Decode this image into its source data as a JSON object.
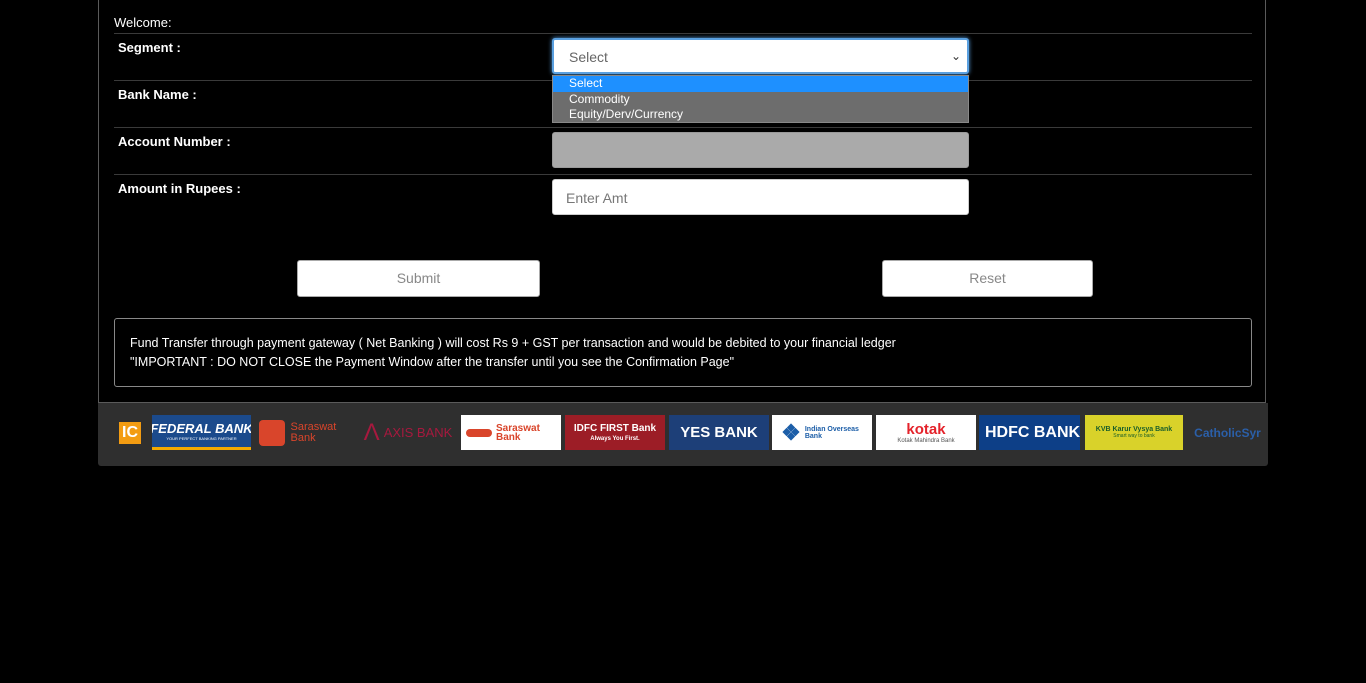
{
  "form": {
    "welcome": "Welcome:",
    "segment_label": "Segment :",
    "segment_value": "Select",
    "segment_options": [
      "Select",
      "Commodity",
      "Equity/Derv/Currency"
    ],
    "bank_name_label": "Bank Name :",
    "account_number_label": "Account Number :",
    "amount_label": "Amount in Rupees :",
    "amount_placeholder": "Enter Amt",
    "submit_label": "Submit",
    "reset_label": "Reset"
  },
  "notice": {
    "line1": "Fund Transfer through payment gateway ( Net Banking ) will cost Rs 9 + GST per transaction and would be debited to your financial ledger",
    "line2": "\"IMPORTANT : DO NOT CLOSE the Payment Window after the transfer until you see the Confirmation Page\""
  },
  "banks": [
    {
      "name": "IC",
      "icon": "ic-logo",
      "bg": "#2f2f2f",
      "fg": "#f39c12"
    },
    {
      "name": "FEDERAL BANK",
      "sub": "YOUR PERFECT BANKING PARTNER",
      "icon": "federal-bank-logo",
      "bg": "#1b4a8c",
      "fg": "#ffffff"
    },
    {
      "name": "Saraswat Bank",
      "icon": "saraswat-bank-logo",
      "bg": "#2f2f2f",
      "fg": "#d9452b"
    },
    {
      "name": "AXIS BANK",
      "icon": "axis-bank-logo",
      "bg": "#2f2f2f",
      "fg": "#a6193e"
    },
    {
      "name": "Saraswat Bank",
      "icon": "saraswat-bank-logo-2",
      "bg": "#ffffff",
      "fg": "#d9452b"
    },
    {
      "name": "IDFC FIRST Bank",
      "sub": "Always You First.",
      "icon": "idfc-first-bank-logo",
      "bg": "#9c1d26",
      "fg": "#ffffff"
    },
    {
      "name": "YES BANK",
      "icon": "yes-bank-logo",
      "bg": "#1d3f78",
      "fg": "#ffffff"
    },
    {
      "name": "Indian Overseas Bank",
      "icon": "indian-overseas-bank-logo",
      "bg": "#ffffff",
      "fg": "#1c5ea8"
    },
    {
      "name": "kotak",
      "sub": "Kotak Mahindra Bank",
      "icon": "kotak-logo",
      "bg": "#ffffff",
      "fg": "#e4232b"
    },
    {
      "name": "HDFC BANK",
      "icon": "hdfc-bank-logo",
      "bg": "#0d3f87",
      "fg": "#ffffff"
    },
    {
      "name": "KVB Karur Vysya Bank",
      "sub": "Smart way to bank",
      "icon": "karur-vysya-bank-logo",
      "bg": "#d9d22a",
      "fg": "#1a5e2a"
    },
    {
      "name": "CatholicSyr",
      "icon": "catholic-syrian-bank-logo",
      "bg": "#2f2f2f",
      "fg": "#2b5fa8"
    }
  ]
}
